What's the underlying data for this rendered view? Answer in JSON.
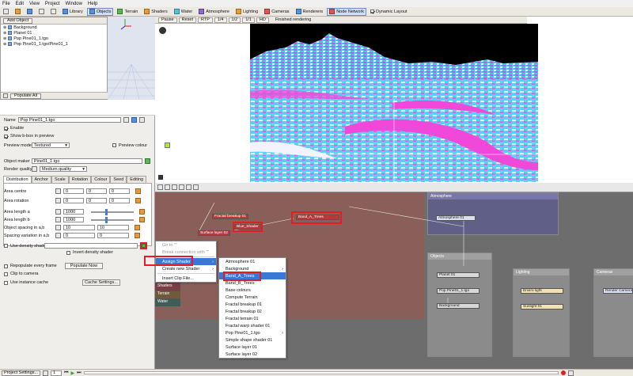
{
  "menu": [
    "File",
    "Edit",
    "View",
    "Project",
    "Window",
    "Help"
  ],
  "toolbar": {
    "buttons": [
      {
        "label": "Library",
        "icon": "library-icon"
      },
      {
        "label": "Objects",
        "icon": "objects-icon",
        "selected": true
      },
      {
        "label": "Terrain",
        "icon": "terrain-icon"
      },
      {
        "label": "Shaders",
        "icon": "shaders-icon"
      },
      {
        "label": "Water",
        "icon": "water-icon"
      },
      {
        "label": "Atmosphere",
        "icon": "atmosphere-icon"
      },
      {
        "label": "Lighting",
        "icon": "lighting-icon"
      },
      {
        "label": "Cameras",
        "icon": "cameras-icon"
      },
      {
        "label": "Renderers",
        "icon": "renderers-icon"
      },
      {
        "label": "Node Network",
        "icon": "node-network-icon",
        "selected": true
      }
    ],
    "dynamic_layout": "Dynamic Layout"
  },
  "scene_tree": {
    "add_object": "Add Object",
    "items": [
      "Background",
      "Planet 01",
      "Pop Pine01_1.tgo",
      "Pop Pine01_1.tgo/Pine01_1"
    ],
    "populate_all": "Populate All"
  },
  "render_toolbar": {
    "buttons": [
      "Pause",
      "Reset",
      "RTP",
      "1/4",
      "1/2",
      "1/1",
      "HD"
    ],
    "status": "Finished rendering"
  },
  "properties": {
    "name_label": "Name",
    "name_value": "Pop Pine01_1.tgo",
    "enable": "Enable",
    "show_bbox": "Show b-box in preview",
    "preview_mode_label": "Preview mode",
    "preview_mode_value": "Textured",
    "preview_colour": "Preview colour",
    "object_maker_label": "Object maker",
    "object_maker_value": "Pine01_1.tgo",
    "render_quality_label": "Render quality",
    "render_quality_value": "Medium quality",
    "tabs": [
      "Distribution",
      "Anchor",
      "Scale",
      "Rotation",
      "Colour",
      "Seed",
      "Editing"
    ],
    "fields": [
      {
        "label": "Area centre",
        "values": [
          "0",
          "0",
          "0"
        ]
      },
      {
        "label": "Area rotation",
        "values": [
          "0",
          "0",
          "0"
        ]
      },
      {
        "label": "Area length a",
        "values": [
          "1000"
        ]
      },
      {
        "label": "Area length b",
        "values": [
          "1000"
        ]
      },
      {
        "label": "Object spacing in a,b",
        "values": [
          "10",
          "10"
        ]
      },
      {
        "label": "Spacing variation in a,b",
        "values": [
          "0",
          "0"
        ]
      }
    ],
    "use_density_shader": "Use density shader",
    "invert_density_shader": "Invert density shader",
    "repopulate": "Repopulate every frame",
    "populate_now": "Populate Now",
    "clip_to_camera": "Clip to camera",
    "use_instance_cache": "Use instance cache",
    "cache_settings": "Cache Settings..."
  },
  "context_menu": {
    "items": [
      {
        "label": "Go to \"\"",
        "disabled": true
      },
      {
        "label": "Break connection with \"\"",
        "disabled": true
      },
      {
        "label": "Assign Shader",
        "highlighted": true,
        "submenu": true
      },
      {
        "label": "Create new Shader",
        "submenu": true
      },
      {
        "label": "Insert Clip File..."
      }
    ]
  },
  "submenu": {
    "items": [
      {
        "label": "Atmosphere 01"
      },
      {
        "label": "Background",
        "submenu": true
      },
      {
        "label": "Band_A_Trees",
        "highlighted": true
      },
      {
        "label": "Band_B_Trees"
      },
      {
        "label": "Base colours"
      },
      {
        "label": "Compute Terrain"
      },
      {
        "label": "Fractal breakup 01"
      },
      {
        "label": "Fractal breakup 02"
      },
      {
        "label": "Fractal terrain 01"
      },
      {
        "label": "Fractal warp shader 01"
      },
      {
        "label": "Pop Pine01_1.tgo",
        "submenu": true
      },
      {
        "label": "Simple shape shader 01"
      },
      {
        "label": "Surface layer 01"
      },
      {
        "label": "Surface layer 02"
      }
    ]
  },
  "nodes": {
    "fractal_breakup": "Fractal breakup 01",
    "blue_shader": "Blue_Shader",
    "band_a_trees": "Band_A_Trees",
    "surface_layer": "Surface layer 02",
    "atmosphere_group": "Atmosphere",
    "atmosphere_node": "Atmosphere 01",
    "objects_group": "Objects",
    "planet": "Planet 01",
    "pop_pine": "Pop Pine01_1.tgo",
    "background": "Background",
    "lighting_group": "Lighting",
    "enviro_light": "Enviro light",
    "sunlight": "Sunlight 01",
    "cameras_group": "Cameras",
    "render_camera": "Render Camera",
    "left_labels": [
      "Shaders",
      "Terrain",
      "Water"
    ]
  },
  "status": {
    "project_settings": "Project Settings...",
    "frame": "1"
  }
}
